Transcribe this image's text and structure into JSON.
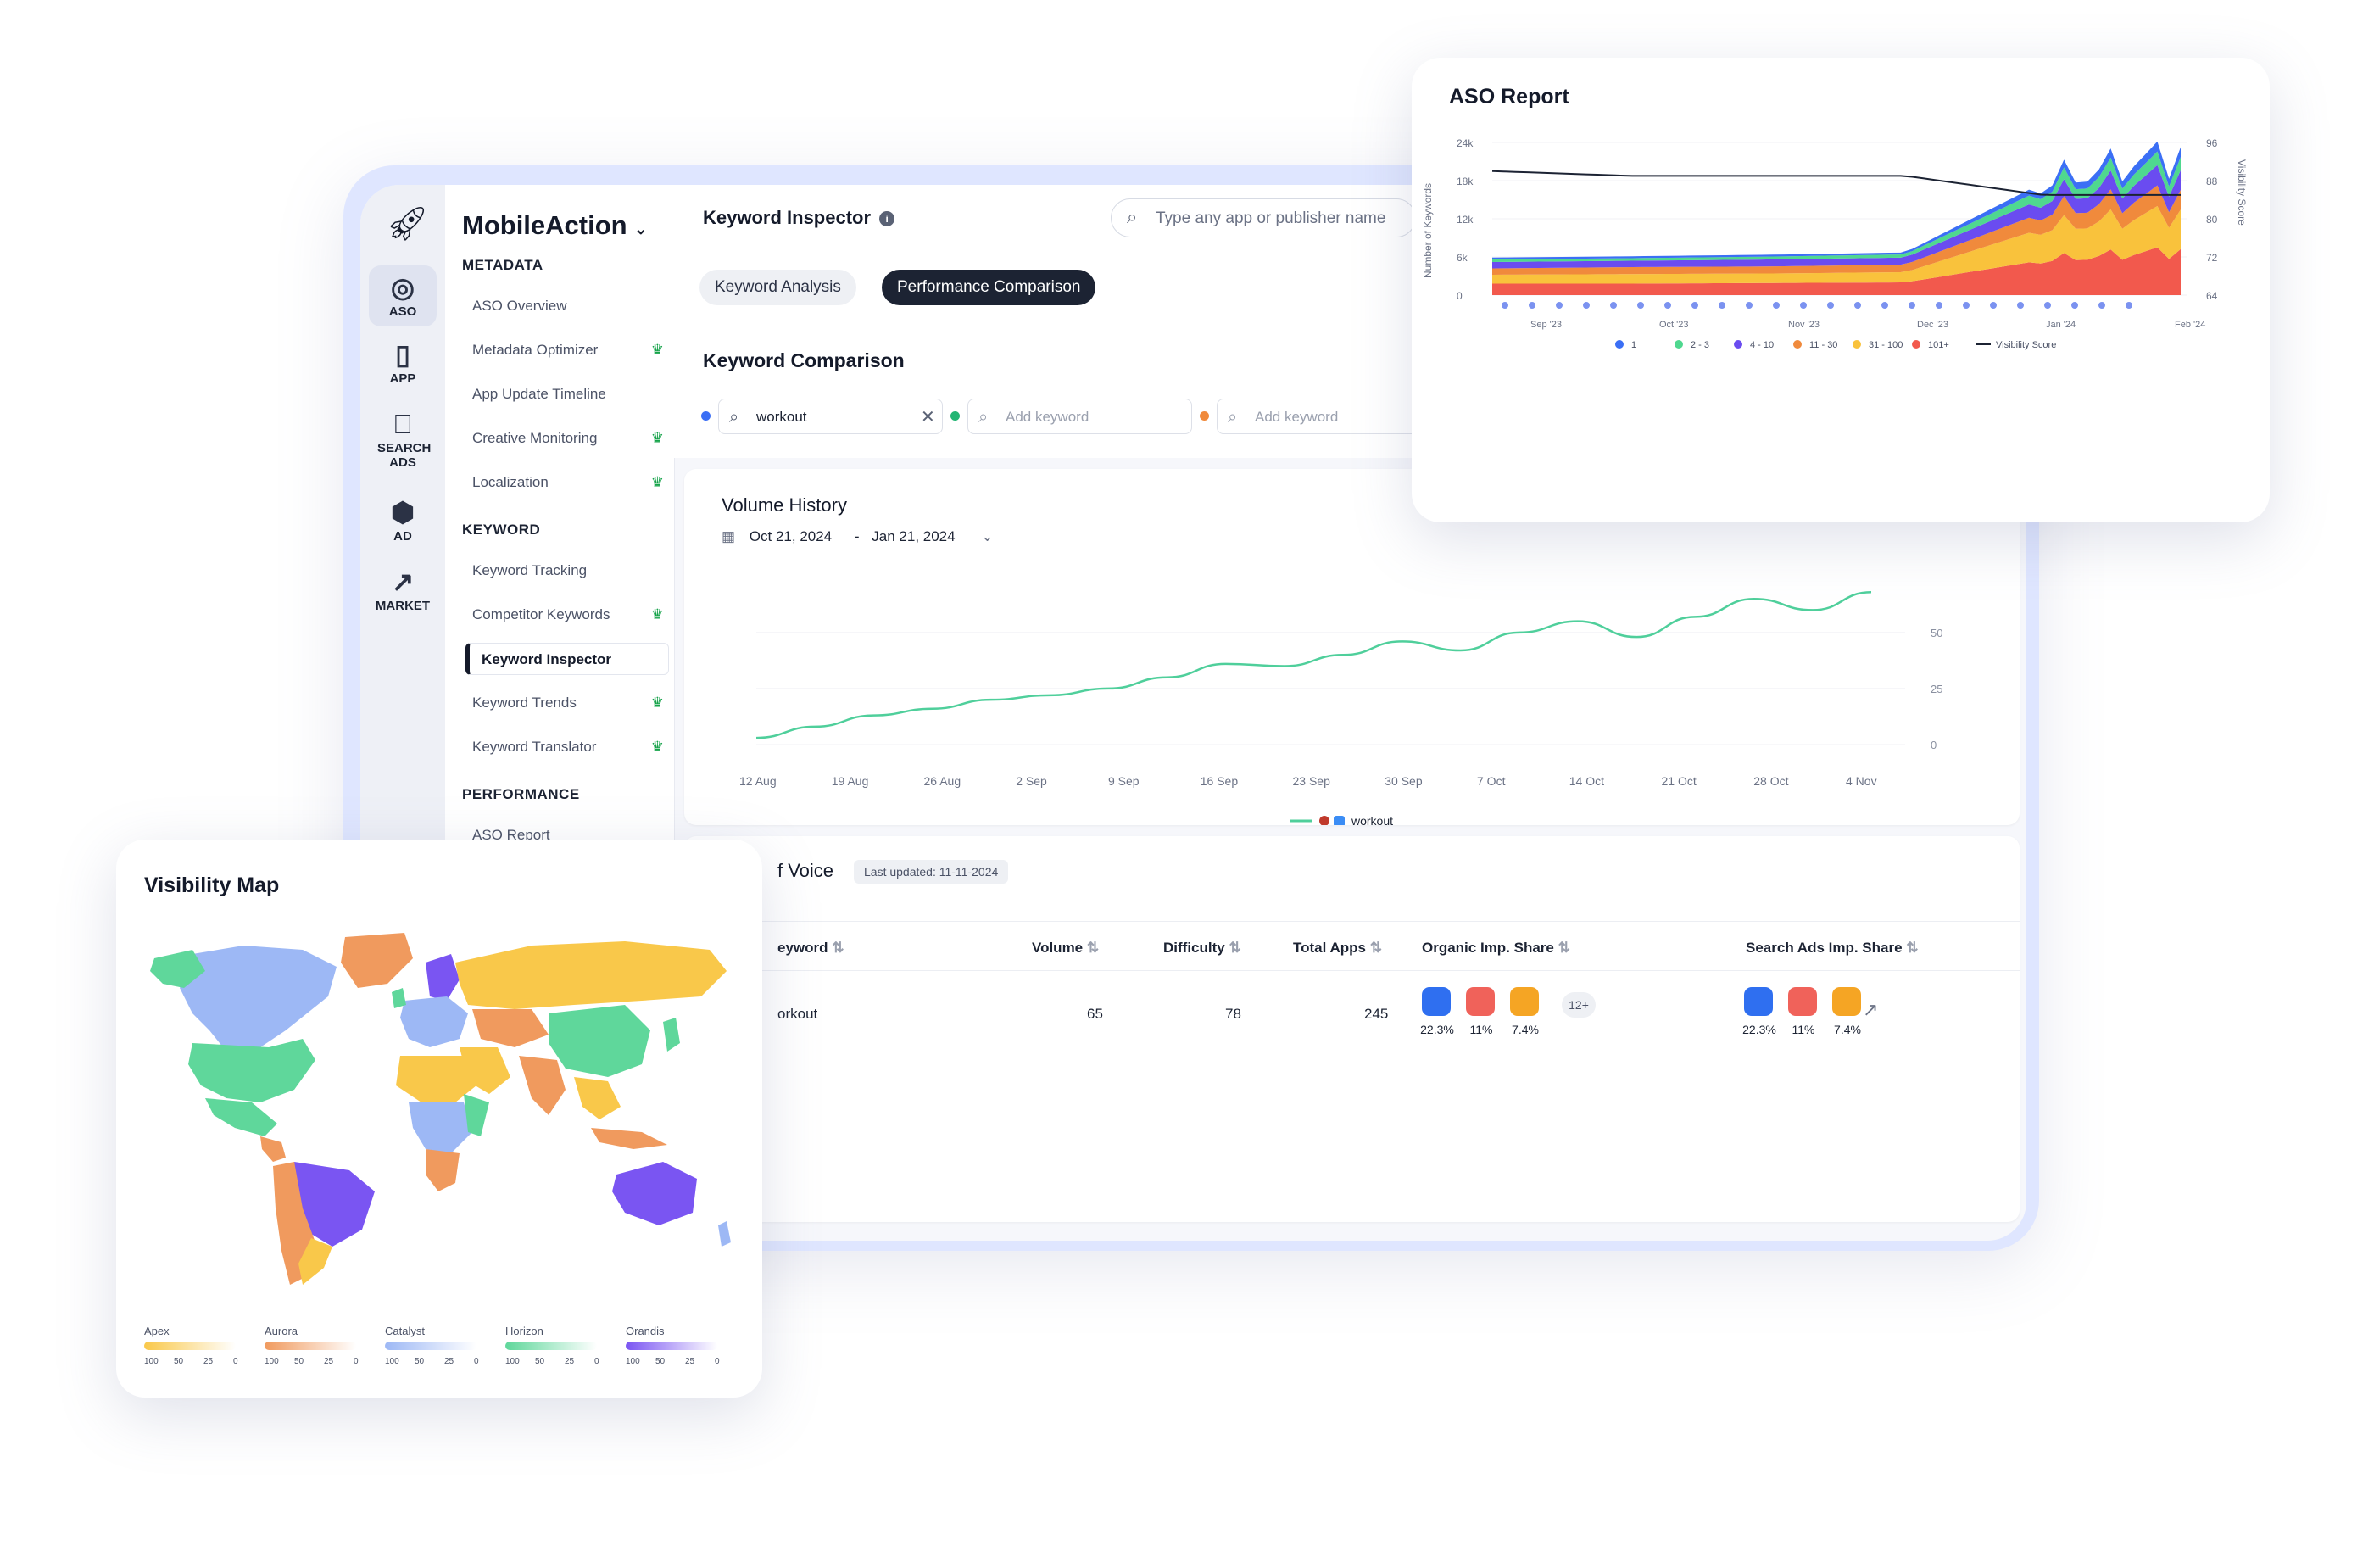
{
  "app": {
    "brand": "MobileAction",
    "rail": [
      {
        "label": "ASO",
        "icon": "target-icon"
      },
      {
        "label": "APP",
        "icon": "phone-icon"
      },
      {
        "label": "SEARCH ADS",
        "icon": "apple-icon"
      },
      {
        "label": "AD",
        "icon": "ad-tag-icon"
      },
      {
        "label": "MARKET",
        "icon": "trend-icon"
      }
    ],
    "sidebar": {
      "sections": [
        {
          "title": "METADATA",
          "items": [
            {
              "label": "ASO Overview",
              "premium": false
            },
            {
              "label": "Metadata Optimizer",
              "premium": true
            },
            {
              "label": "App Update Timeline",
              "premium": false
            },
            {
              "label": "Creative Monitoring",
              "premium": true
            },
            {
              "label": "Localization",
              "premium": true
            }
          ]
        },
        {
          "title": "KEYWORD",
          "items": [
            {
              "label": "Keyword Tracking",
              "premium": false
            },
            {
              "label": "Competitor Keywords",
              "premium": true
            },
            {
              "label": "Keyword Inspector",
              "premium": false,
              "active": true
            },
            {
              "label": "Keyword Trends",
              "premium": true
            },
            {
              "label": "Keyword Translator",
              "premium": true
            }
          ]
        },
        {
          "title": "PERFORMANCE",
          "items": [
            {
              "label": "ASO Report",
              "premium": false
            }
          ]
        }
      ]
    }
  },
  "header": {
    "title": "Keyword Inspector",
    "search_placeholder": "Type any app or publisher name"
  },
  "tabs": [
    {
      "label": "Keyword Analysis",
      "active": false
    },
    {
      "label": "Performance Comparison",
      "active": true
    }
  ],
  "comparison": {
    "title": "Keyword Comparison",
    "keywords": [
      {
        "value": "workout",
        "placeholder": "",
        "color": "#3b6ff5"
      },
      {
        "value": "",
        "placeholder": "Add keyword",
        "color": "#22b573"
      },
      {
        "value": "",
        "placeholder": "Add keyword",
        "color": "#f08a3c"
      }
    ]
  },
  "volume_history": {
    "title": "Volume History",
    "date_from": "Oct 21, 2024",
    "date_sep": "-",
    "date_to": "Jan 21, 2024",
    "legend": "workout"
  },
  "share_of_voice": {
    "title": "f Voice",
    "updated": "Last updated: 11-11-2024",
    "columns": [
      "eyword",
      "Volume",
      "Difficulty",
      "Total Apps",
      "Organic Imp. Share",
      "Search Ads Imp. Share"
    ],
    "row": {
      "keyword": "orkout",
      "volume": "65",
      "difficulty": "78",
      "total_apps": "245",
      "organic": [
        {
          "pct": "22.3%",
          "color": "#2f6ff0"
        },
        {
          "pct": "11%",
          "color": "#f0625a"
        },
        {
          "pct": "7.4%",
          "color": "#f5a524"
        }
      ],
      "organic_more": "12+",
      "ads": [
        {
          "pct": "22.3%",
          "color": "#2f6ff0"
        },
        {
          "pct": "11%",
          "color": "#f0625a"
        },
        {
          "pct": "7.4%",
          "color": "#f5a524"
        }
      ]
    }
  },
  "aso_report": {
    "title": "ASO Report",
    "y_left_label": "Number of Keywords",
    "y_right_label": "Visibility Score",
    "y_left_ticks": [
      "24k",
      "18k",
      "12k",
      "6k",
      "0"
    ],
    "y_right_ticks": [
      "96",
      "88",
      "80",
      "72",
      "64"
    ],
    "x_ticks": [
      "Sep '23",
      "Oct '23",
      "Nov '23",
      "Dec '23",
      "Jan '24",
      "Feb '24"
    ],
    "legend": [
      {
        "label": "1",
        "color": "#3b6ff5"
      },
      {
        "label": "2 - 3",
        "color": "#4fd88f"
      },
      {
        "label": "4 - 10",
        "color": "#6a4cf0"
      },
      {
        "label": "11 - 30",
        "color": "#f08a3c"
      },
      {
        "label": "31 - 100",
        "color": "#f9c23c"
      },
      {
        "label": "101+",
        "color": "#f2594d"
      },
      {
        "label": "Visibility Score",
        "color": "#1c2333"
      }
    ]
  },
  "visibility_map": {
    "title": "Visibility Map",
    "legend": [
      {
        "label": "Apex",
        "color": "#f9c84a"
      },
      {
        "label": "Aurora",
        "color": "#f09a5e"
      },
      {
        "label": "Catalyst",
        "color": "#9db8f5"
      },
      {
        "label": "Horizon",
        "color": "#5fd79b"
      },
      {
        "label": "Orandis",
        "color": "#7a55f2"
      }
    ],
    "scale": [
      "100",
      "50",
      "25",
      "0"
    ]
  },
  "chart_data": [
    {
      "type": "line",
      "title": "Volume History",
      "x": [
        "12 Aug",
        "19 Aug",
        "26 Aug",
        "2 Sep",
        "9 Sep",
        "16 Sep",
        "23 Sep",
        "30 Sep",
        "7 Oct",
        "14 Oct",
        "21 Oct",
        "28 Oct",
        "4 Nov"
      ],
      "y_ticks": [
        "50",
        "25",
        "0"
      ],
      "ylim": [
        0,
        70
      ],
      "series": [
        {
          "name": "workout",
          "color": "#4fcf9b",
          "values": [
            3,
            8,
            13,
            16,
            20,
            22,
            25,
            30,
            36,
            35,
            40,
            46,
            42,
            50,
            55,
            48,
            57,
            65,
            60,
            68
          ]
        }
      ]
    },
    {
      "type": "area",
      "title": "ASO Report",
      "x_ticks": [
        "Sep '23",
        "Oct '23",
        "Nov '23",
        "Dec '23",
        "Jan '24",
        "Feb '24"
      ],
      "ylim_left": [
        0,
        24000
      ],
      "ylim_right": [
        64,
        96
      ],
      "stack_order": [
        "101+",
        "31 - 100",
        "11 - 30",
        "4 - 10",
        "2 - 3",
        "1"
      ],
      "series": [
        {
          "name": "101+",
          "color": "#f2594d",
          "values": [
            1800,
            1800,
            1900,
            2000,
            5500,
            7000
          ]
        },
        {
          "name": "31 - 100",
          "color": "#f9c23c",
          "values": [
            1400,
            1500,
            1500,
            1600,
            5000,
            6000
          ]
        },
        {
          "name": "11 - 30",
          "color": "#f08a3c",
          "values": [
            1000,
            1100,
            1100,
            1200,
            2500,
            3000
          ]
        },
        {
          "name": "4 - 10",
          "color": "#6a4cf0",
          "values": [
            1000,
            1000,
            1100,
            1100,
            2200,
            3000
          ]
        },
        {
          "name": "2 - 3",
          "color": "#4fd88f",
          "values": [
            400,
            400,
            450,
            500,
            1500,
            2000
          ]
        },
        {
          "name": "1",
          "color": "#3b6ff5",
          "values": [
            300,
            300,
            300,
            300,
            1000,
            1500
          ]
        }
      ],
      "visibility_score": [
        90,
        89,
        89,
        89,
        85,
        85
      ]
    }
  ]
}
